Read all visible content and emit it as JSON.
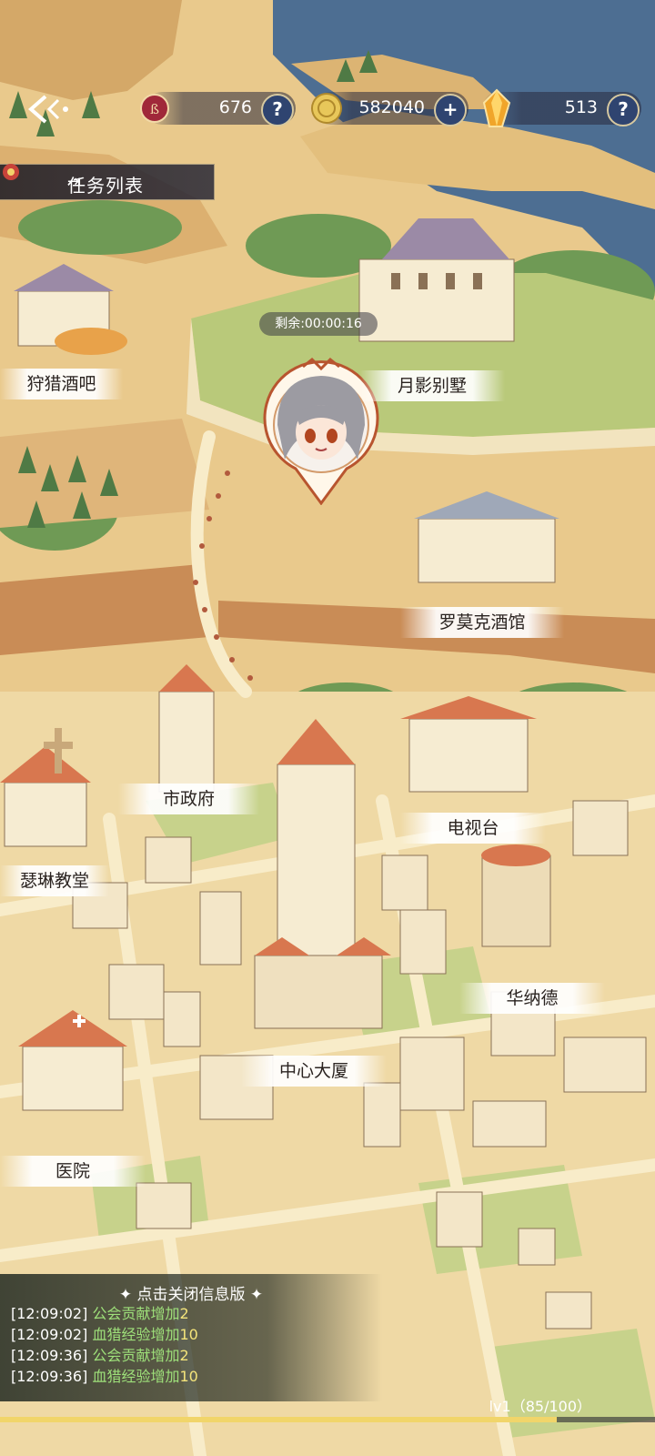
{
  "topbar": {
    "stamina": {
      "icon": "stamina-seal-icon",
      "value": "676"
    },
    "gold": {
      "icon": "gold-coin-icon",
      "value": "582040"
    },
    "crystal": {
      "icon": "amber-crystal-icon",
      "value": "513"
    },
    "help_symbol": "?",
    "add_symbol": "+"
  },
  "task_list": {
    "label": "任务列表",
    "arrow": "⇥"
  },
  "timer": "剩余:00:00:16",
  "locations": {
    "hunter_bar": "狩猎酒吧",
    "moon_villa": "月影别墅",
    "romoc_tavern": "罗莫克酒馆",
    "city_hall": "市政府",
    "tv_station": "电视台",
    "church": "瑟琳教堂",
    "warnard": "华纳德",
    "center_tower": "中心大厦",
    "hospital": "医院"
  },
  "info_panel": {
    "header": "✦ 点击关闭信息版 ✦",
    "logs": [
      {
        "time": "[12:09:02]",
        "key": "公会贡献",
        "action": "增加",
        "amount": "2"
      },
      {
        "time": "[12:09:02]",
        "key": "血猎经验",
        "action": "增加",
        "amount": "10"
      },
      {
        "time": "[12:09:36]",
        "key": "公会贡献",
        "action": "增加",
        "amount": "2"
      },
      {
        "time": "[12:09:36]",
        "key": "血猎经验",
        "action": "增加",
        "amount": "10"
      }
    ]
  },
  "level": {
    "text": "lv1（85/100）",
    "progress": 0.85
  },
  "colors": {
    "sand": "#e9c98c",
    "grass": "#b9c97a",
    "water": "#4d6e92",
    "roof": "#d8774f",
    "road": "#f6e6bd"
  }
}
